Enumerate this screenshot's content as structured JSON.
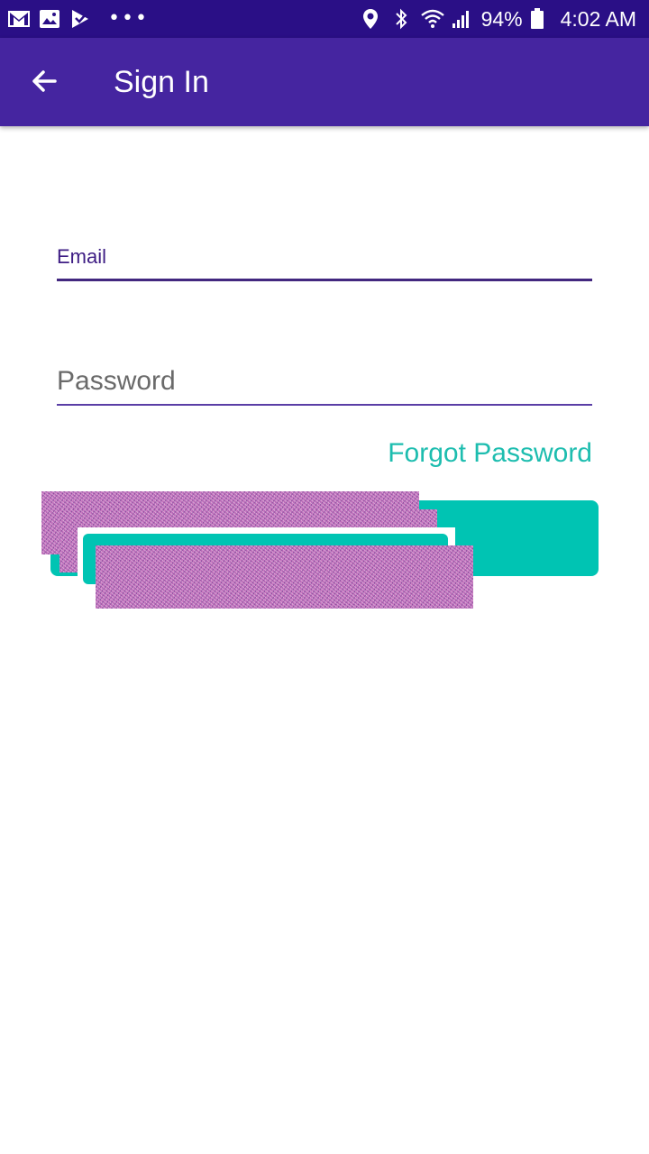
{
  "status_bar": {
    "battery": "94%",
    "time": "4:02 AM",
    "left_icons": [
      "gmail-icon",
      "gallery-icon",
      "play-store-icon",
      "more-dots-icon"
    ],
    "right_icons": [
      "location-icon",
      "bluetooth-icon",
      "wifi-icon",
      "signal-icon",
      "battery-icon"
    ]
  },
  "app_bar": {
    "title": "Sign In",
    "back_icon": "arrow-left-icon"
  },
  "form": {
    "email": {
      "label": "Email",
      "value": ""
    },
    "password": {
      "placeholder": "Password",
      "value": ""
    },
    "forgot_label": "Forgot Password"
  },
  "colors": {
    "status_bar": "#2a0f86",
    "app_bar": "#4525a0",
    "accent_teal": "#00c4b3",
    "field_underline": "#42277f"
  }
}
